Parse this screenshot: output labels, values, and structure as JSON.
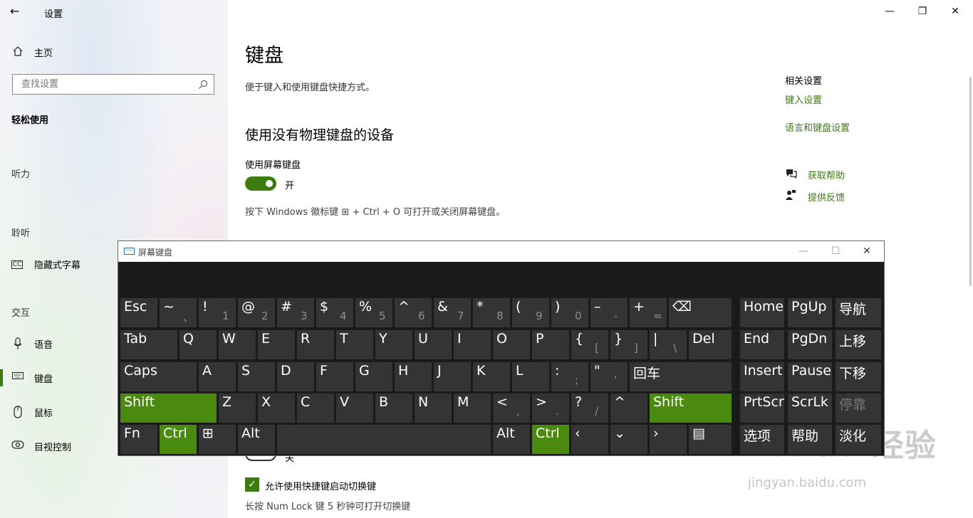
{
  "window": {
    "title": "设置",
    "minimize": "—",
    "restore": "❐",
    "close": "✕",
    "back": "←"
  },
  "sidebar": {
    "home": "主页",
    "search_placeholder": "查找设置",
    "category": "轻松使用",
    "sections": {
      "hearing": "听力",
      "listen": "聆听",
      "interaction": "交互"
    },
    "items": [
      {
        "label": "隐藏式字幕",
        "icon": "cc-icon"
      },
      {
        "label": "语音",
        "icon": "microphone-icon"
      },
      {
        "label": "键盘",
        "icon": "keyboard-icon",
        "selected": true
      },
      {
        "label": "鼠标",
        "icon": "mouse-icon"
      },
      {
        "label": "目视控制",
        "icon": "eye-control-icon"
      }
    ]
  },
  "main": {
    "title": "键盘",
    "subtitle": "便于键入和使用键盘快捷方式。",
    "section_title": "使用没有物理键盘的设备",
    "osk_label": "使用屏幕键盘",
    "osk_state": "开",
    "osk_hint": "按下 Windows 徽标键 ⊞ + Ctrl + O 可打开或关闭屏幕键盘。",
    "partial_toggle_state": "关",
    "checkbox_label": "允许使用快捷键启动切换键",
    "bottom_hint": "长按 Num Lock 键 5 秒钟可打开切换键"
  },
  "related": {
    "title": "相关设置",
    "links": [
      "键入设置",
      "语言和键盘设置"
    ],
    "help": "获取帮助",
    "feedback": "提供反馈"
  },
  "osk": {
    "title": "屏幕键盘",
    "keys": [
      {
        "m": "Esc"
      },
      {
        "m": "~",
        "s": "、"
      },
      {
        "m": "!",
        "s": "1"
      },
      {
        "m": "@",
        "s": "2"
      },
      {
        "m": "#",
        "s": "3"
      },
      {
        "m": "$",
        "s": "4"
      },
      {
        "m": "%",
        "s": "5"
      },
      {
        "m": "^",
        "s": "6"
      },
      {
        "m": "&",
        "s": "7"
      },
      {
        "m": "*",
        "s": "8"
      },
      {
        "m": "(",
        "s": "9"
      },
      {
        "m": ")",
        "s": "0"
      },
      {
        "m": "–",
        "s": "-"
      },
      {
        "m": "+",
        "s": "="
      },
      {
        "m": "⌫"
      },
      {
        "m": "Home"
      },
      {
        "m": "PgUp"
      },
      {
        "m": "导航"
      },
      {
        "m": "Tab"
      },
      {
        "m": "Q"
      },
      {
        "m": "W"
      },
      {
        "m": "E"
      },
      {
        "m": "R"
      },
      {
        "m": "T"
      },
      {
        "m": "Y"
      },
      {
        "m": "U"
      },
      {
        "m": "I"
      },
      {
        "m": "O"
      },
      {
        "m": "P"
      },
      {
        "m": "{",
        "s": "["
      },
      {
        "m": "}",
        "s": "]"
      },
      {
        "m": "|",
        "s": "\\"
      },
      {
        "m": "Del"
      },
      {
        "m": "End"
      },
      {
        "m": "PgDn"
      },
      {
        "m": "上移"
      },
      {
        "m": "Caps"
      },
      {
        "m": "A"
      },
      {
        "m": "S"
      },
      {
        "m": "D"
      },
      {
        "m": "F"
      },
      {
        "m": "G"
      },
      {
        "m": "H"
      },
      {
        "m": "J"
      },
      {
        "m": "K"
      },
      {
        "m": "L"
      },
      {
        "m": ":",
        "s": ";"
      },
      {
        "m": "\"",
        "s": "'"
      },
      {
        "m": "回车"
      },
      {
        "m": "Insert"
      },
      {
        "m": "Pause"
      },
      {
        "m": "下移"
      },
      {
        "m": "Shift"
      },
      {
        "m": "Z"
      },
      {
        "m": "X"
      },
      {
        "m": "C"
      },
      {
        "m": "V"
      },
      {
        "m": "B"
      },
      {
        "m": "N"
      },
      {
        "m": "M"
      },
      {
        "m": "<",
        "s": ","
      },
      {
        "m": ">",
        "s": "."
      },
      {
        "m": "?",
        "s": "/"
      },
      {
        "m": "^"
      },
      {
        "m": "Shift"
      },
      {
        "m": "PrtScn"
      },
      {
        "m": "ScrLk"
      },
      {
        "m": "停靠"
      },
      {
        "m": "Fn"
      },
      {
        "m": "Ctrl"
      },
      {
        "m": "⊞"
      },
      {
        "m": "Alt"
      },
      {
        "m": ""
      },
      {
        "m": "Alt"
      },
      {
        "m": "Ctrl"
      },
      {
        "m": "‹"
      },
      {
        "m": "⌄"
      },
      {
        "m": "›"
      },
      {
        "m": "▤"
      },
      {
        "m": "选项"
      },
      {
        "m": "帮助"
      },
      {
        "m": "淡化"
      }
    ]
  },
  "watermark": {
    "text": "Bai du 经验",
    "url": "jingyan.baidu.com"
  }
}
